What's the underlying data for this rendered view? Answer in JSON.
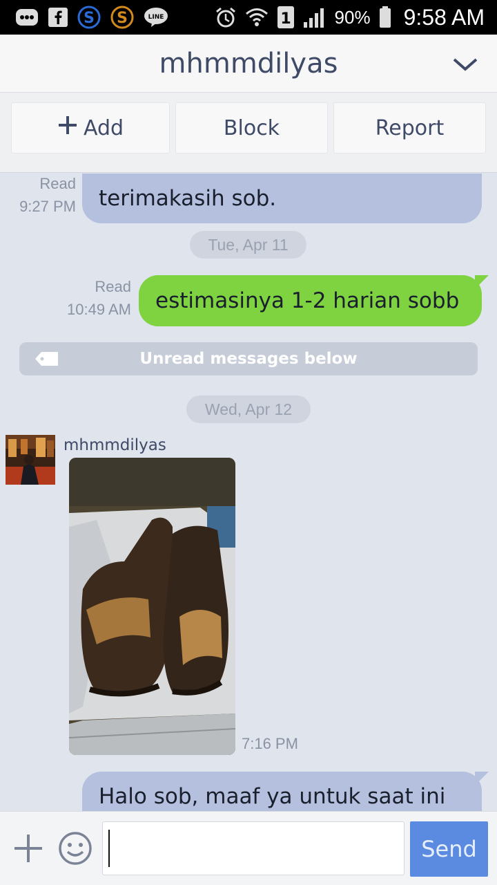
{
  "status_bar": {
    "icons": [
      "bbm-icon",
      "facebook-icon",
      "s-app-icon",
      "s-app-orange-icon",
      "line-icon",
      "alarm-icon",
      "wifi-icon",
      "sim-1-icon",
      "signal-icon",
      "battery-icon"
    ],
    "battery": "90%",
    "time": "9:58 AM"
  },
  "header": {
    "title": "mhmmdilyas"
  },
  "actions": {
    "add": "Add",
    "block": "Block",
    "report": "Report"
  },
  "messages": [
    {
      "read": "Read",
      "time": "9:27 PM",
      "text": "terimakasih sob."
    },
    {
      "date": "Tue, Apr 11"
    },
    {
      "read": "Read",
      "time": "10:49 AM",
      "text": "estimasinya 1-2 harian sobb"
    },
    {
      "unread_notice": "Unread messages below"
    },
    {
      "date": "Wed, Apr 12"
    },
    {
      "sender": "mhmmdilyas",
      "time": "7:16 PM"
    },
    {
      "text": "Halo sob, maaf ya untuk saat ini"
    }
  ],
  "input": {
    "placeholder": "",
    "send_label": "Send"
  },
  "colors": {
    "accent": "#5b8be0",
    "my_bubble": "#7fd240",
    "their_bubble": "#b4c0dd",
    "title_text": "#3e4a66"
  }
}
